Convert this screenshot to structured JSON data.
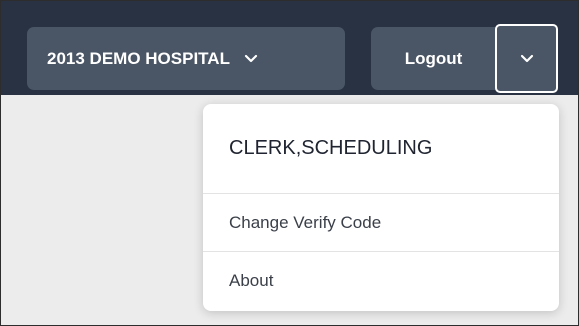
{
  "header": {
    "facility_button_label": "2013 DEMO HOSPITAL",
    "logout_label": "Logout"
  },
  "user_menu": {
    "user_name": "CLERK,SCHEDULING",
    "items": [
      {
        "label": "Change Verify Code"
      },
      {
        "label": "About"
      }
    ]
  },
  "colors": {
    "topbar_bg": "#283242",
    "button_bg": "#4a5565",
    "menu_bg": "#ffffff"
  },
  "icons": {
    "facility_chevron": "chevron-down-icon",
    "user_menu_chevron": "chevron-down-icon"
  }
}
